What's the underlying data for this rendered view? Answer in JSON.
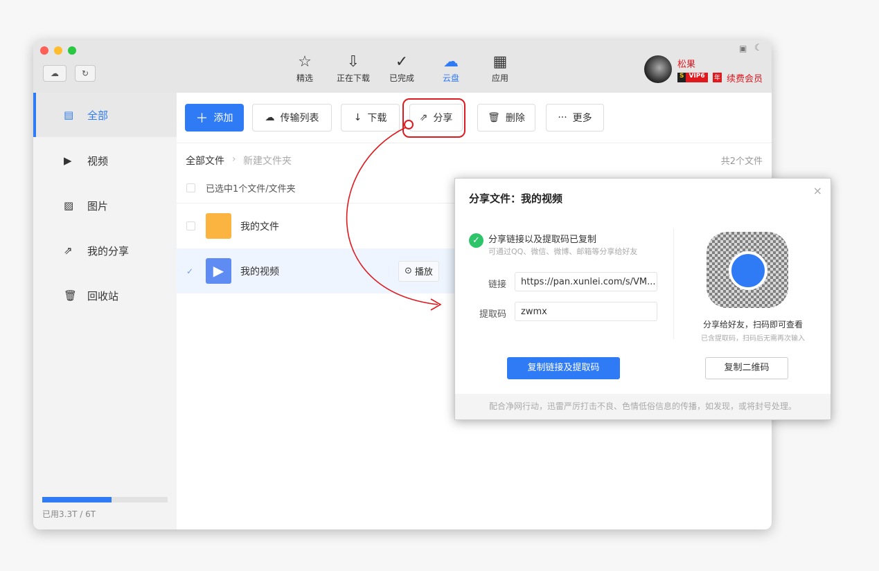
{
  "nav": [
    {
      "label": "精选",
      "icon": "star-icon"
    },
    {
      "label": "正在下载",
      "icon": "download-icon"
    },
    {
      "label": "已完成",
      "icon": "check-circle-icon"
    },
    {
      "label": "云盘",
      "icon": "cloud-icon"
    },
    {
      "label": "应用",
      "icon": "apps-icon"
    }
  ],
  "user": {
    "name": "松果",
    "vip": "VIP6",
    "year": "年",
    "renew": "续费会员"
  },
  "sidebar": {
    "items": [
      {
        "label": "全部"
      },
      {
        "label": "视频"
      },
      {
        "label": "图片"
      },
      {
        "label": "我的分享"
      },
      {
        "label": "回收站"
      }
    ],
    "storage": "已用3.3T / 6T",
    "storage_fraction": 0.55
  },
  "toolbar": {
    "add": "添加",
    "transfer": "传输列表",
    "download": "下载",
    "share": "分享",
    "delete": "删除",
    "more": "更多"
  },
  "breadcrumb": {
    "root": "全部文件",
    "current": "新建文件夹",
    "count": "共2个文件"
  },
  "list": {
    "selected_text": "已选中1个文件/文件夹",
    "items": [
      {
        "name": "我的文件"
      },
      {
        "name": "我的视频",
        "action": "播放"
      }
    ]
  },
  "dialog": {
    "title": "分享文件：我的视频",
    "success": "分享链接以及提取码已复制",
    "hint": "可通过QQ、微信、微博、邮箱等分享给好友",
    "link_label": "链接",
    "link": "https://pan.xunlei.com/s/VM...",
    "code_label": "提取码",
    "code": "zwmx",
    "copy_btn": "复制链接及提取码",
    "qr_title": "分享给好友，扫码即可查看",
    "qr_hint": "已含提取码，扫码后无需再次输入",
    "copy_qr": "复制二维码",
    "footer": "配合净网行动，迅雷严厉打击不良、色情低俗信息的传播，如发现，或将封号处理。"
  },
  "colors": {
    "accent": "#2f7bf5",
    "annotation": "#e0191f"
  }
}
